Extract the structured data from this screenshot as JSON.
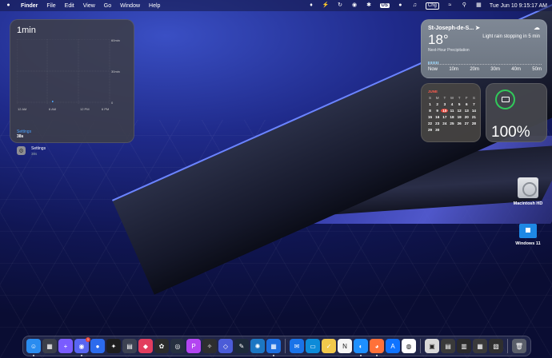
{
  "menubar": {
    "apple": "",
    "app_name": "Finder",
    "menus": [
      "File",
      "Edit",
      "View",
      "Go",
      "Window",
      "Help"
    ],
    "status": {
      "keyboard": "US",
      "battery": "Chg",
      "datetime": "Tue Jun 10  9:15:17 AM"
    }
  },
  "screentime": {
    "title": "1min",
    "y_labels": [
      "60min",
      "30min",
      "0"
    ],
    "x_labels": [
      "12 AM",
      "6 AM",
      "12 PM",
      "6 PM"
    ],
    "category": "Settings",
    "category_time": "38s",
    "app_name": "Settings",
    "app_time": "38s"
  },
  "weather": {
    "city": "St-Joseph-de-S...",
    "temperature": "18°",
    "condition": "Light rain stopping in 5 min",
    "subtitle": "Next-Hour Precipitation",
    "ticks": [
      "Now",
      "10m",
      "20m",
      "30m",
      "40m",
      "50m"
    ]
  },
  "calendar": {
    "month": "JUNE",
    "weekdays": [
      "S",
      "M",
      "T",
      "W",
      "T",
      "F",
      "S"
    ],
    "today": 10,
    "days": [
      "1",
      "2",
      "3",
      "4",
      "5",
      "6",
      "7",
      "8",
      "9",
      "10",
      "11",
      "12",
      "13",
      "14",
      "15",
      "16",
      "17",
      "18",
      "19",
      "20",
      "21",
      "22",
      "23",
      "24",
      "25",
      "26",
      "27",
      "28",
      "29",
      "30"
    ]
  },
  "battery_widget": {
    "percent": "100%"
  },
  "desktop": {
    "macintosh_hd": "Macintosh HD",
    "windows": "Windows 11"
  },
  "dock": {
    "apps": [
      {
        "name": "finder",
        "color": "#2a8cf0",
        "glyph": "☺",
        "running": true
      },
      {
        "name": "launchpad",
        "color": "#3b3f4a",
        "glyph": "▦",
        "running": false
      },
      {
        "name": "craft",
        "color": "#7a5cff",
        "glyph": "+",
        "running": false
      },
      {
        "name": "discord",
        "color": "#5865f2",
        "glyph": "◉",
        "running": true,
        "badge": "1"
      },
      {
        "name": "signal",
        "color": "#2c6bed",
        "glyph": "●",
        "running": false
      },
      {
        "name": "figma",
        "color": "#1e1e1e",
        "glyph": "✦",
        "running": false
      },
      {
        "name": "files",
        "color": "#3d4252",
        "glyph": "▤",
        "running": false
      },
      {
        "name": "cleaner",
        "color": "#e23d5e",
        "glyph": "◆",
        "running": false
      },
      {
        "name": "fl-studio",
        "color": "#2b2b2b",
        "glyph": "✿",
        "running": false
      },
      {
        "name": "blender",
        "color": "#263040",
        "glyph": "◎",
        "running": false
      },
      {
        "name": "phpstorm",
        "color": "#b345f1",
        "glyph": "P",
        "running": false
      },
      {
        "name": "onyx",
        "color": "#2e2e2e",
        "glyph": "✧",
        "running": false
      },
      {
        "name": "disk-util",
        "color": "#4b5cd8",
        "glyph": "◇",
        "running": false
      },
      {
        "name": "xcode-tool",
        "color": "#1d2a3a",
        "glyph": "✎",
        "running": false
      },
      {
        "name": "network",
        "color": "#1c77c3",
        "glyph": "✺",
        "running": false
      },
      {
        "name": "windows-app",
        "color": "#1d6fe0",
        "glyph": "▦",
        "running": true
      },
      {
        "name": "mail",
        "color": "#1a73e8",
        "glyph": "✉",
        "running": false
      },
      {
        "name": "screens",
        "color": "#0d8bd9",
        "glyph": "▭",
        "running": false
      },
      {
        "name": "notes",
        "color": "#f2c94c",
        "glyph": "✓",
        "running": false
      },
      {
        "name": "notion",
        "color": "#f5f5f5",
        "glyph": "N",
        "running": false
      },
      {
        "name": "safari",
        "color": "#1e90ff",
        "glyph": "◐",
        "running": true
      },
      {
        "name": "firefox",
        "color": "#ff7139",
        "glyph": "◕",
        "running": true
      },
      {
        "name": "app-store",
        "color": "#0f73ff",
        "glyph": "A",
        "running": false
      },
      {
        "name": "chrome",
        "color": "#ffffff",
        "glyph": "◍",
        "running": false
      },
      {
        "name": "preview-1",
        "color": "#d8d8d8",
        "glyph": "▣",
        "running": false
      },
      {
        "name": "preview-2",
        "color": "#3a3a3a",
        "glyph": "▤",
        "running": false
      },
      {
        "name": "preview-3",
        "color": "#2a2a2a",
        "glyph": "▥",
        "running": false
      },
      {
        "name": "preview-4",
        "color": "#3a3a3a",
        "glyph": "▦",
        "running": false
      },
      {
        "name": "preview-5",
        "color": "#2f2f2f",
        "glyph": "▧",
        "running": false
      },
      {
        "name": "trash",
        "color": "#5a5f6a",
        "glyph": "🗑",
        "running": false
      }
    ]
  }
}
